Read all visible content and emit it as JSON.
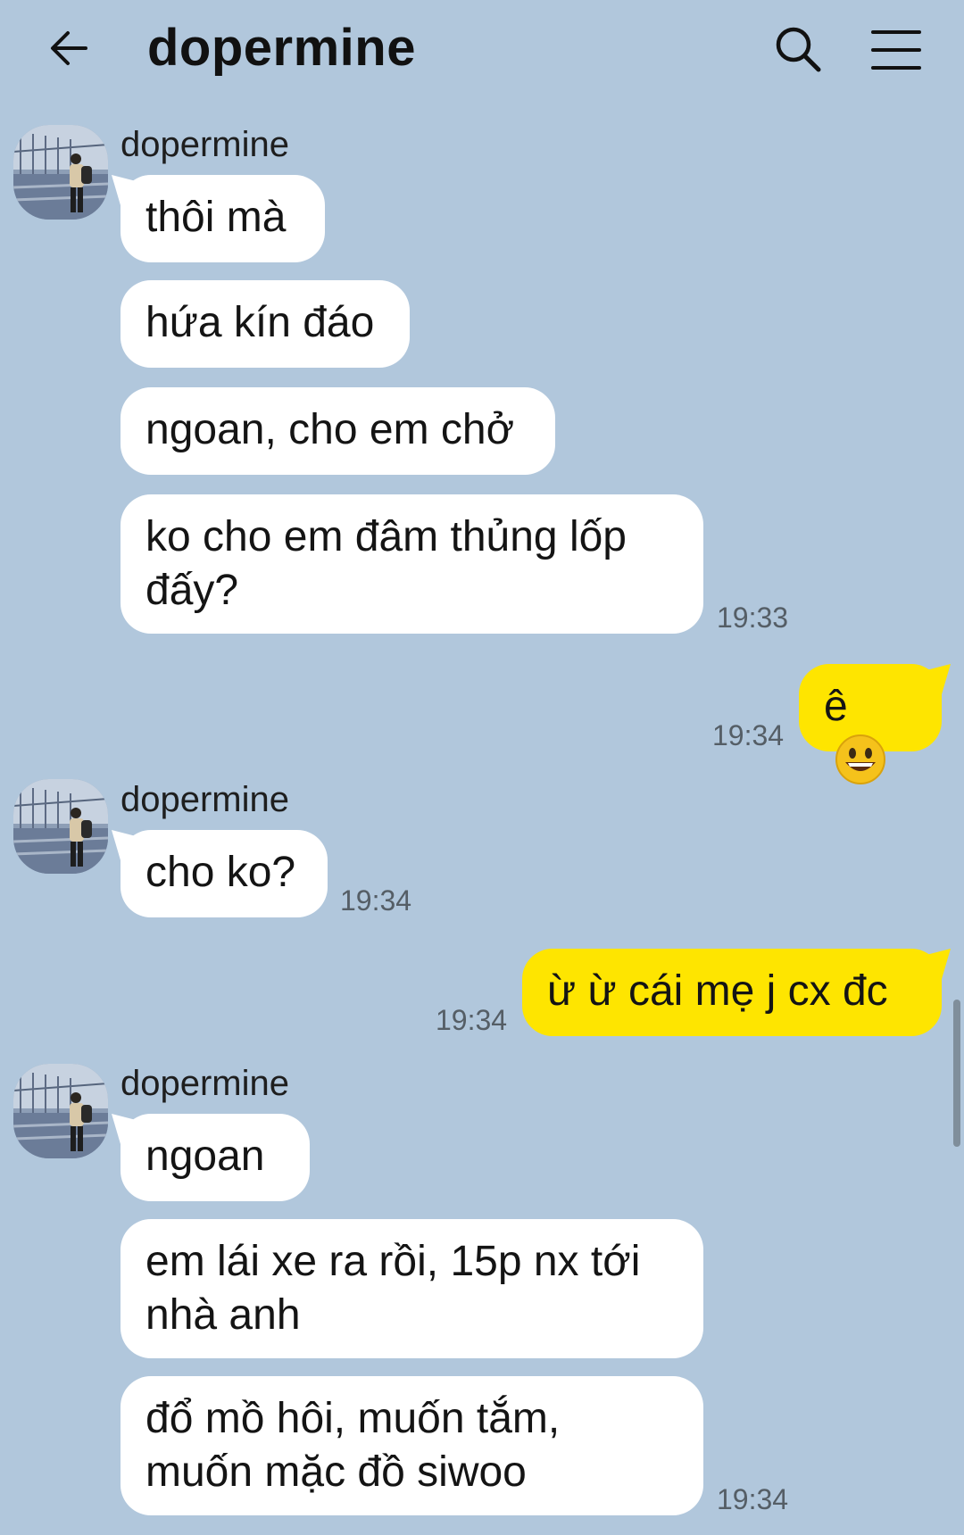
{
  "header": {
    "title": "dopermine",
    "back_icon": "arrow-left-icon",
    "search_icon": "search-icon",
    "menu_icon": "hamburger-menu-icon"
  },
  "colors": {
    "background": "#b1c7dc",
    "incoming_bubble": "#ffffff",
    "outgoing_bubble": "#fee500"
  },
  "messages": [
    {
      "sender": "dopermine",
      "text": "thôi mà"
    },
    {
      "text": "hứa kín đáo"
    },
    {
      "text": "ngoan, cho em chở"
    },
    {
      "text": "ko cho em đâm thủng lốp đấy?",
      "time": "19:33"
    },
    {
      "outgoing": true,
      "text": "ê",
      "emoji": "grinning-face-emoji",
      "time": "19:34"
    },
    {
      "sender": "dopermine",
      "text": "cho ko?",
      "time": "19:34"
    },
    {
      "outgoing": true,
      "text": "ừ ừ cái mẹ j cx đc",
      "time": "19:34"
    },
    {
      "sender": "dopermine",
      "text": "ngoan"
    },
    {
      "text": "em lái xe ra rồi, 15p nx tới nhà anh"
    },
    {
      "text": "đổ mồ hôi, muốn tắm, muốn mặc đồ siwoo",
      "time": "19:34"
    }
  ]
}
